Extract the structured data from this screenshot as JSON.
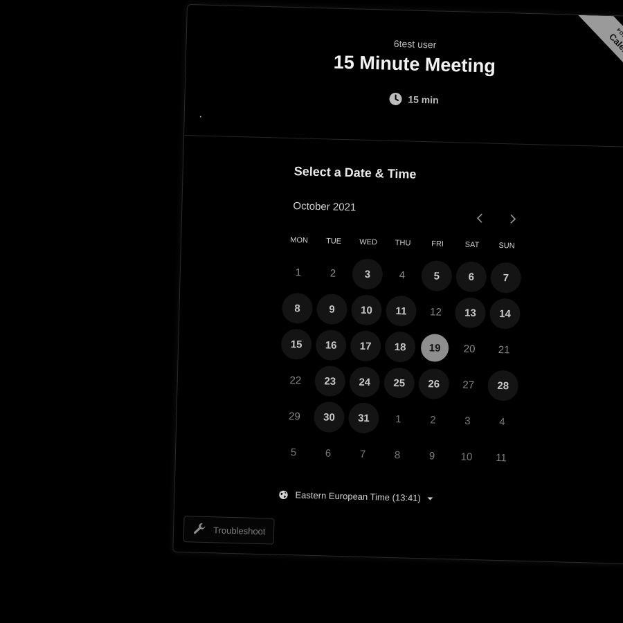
{
  "header": {
    "host_name": "6test user",
    "event_title": "15 Minute Meeting",
    "duration": "15 min"
  },
  "ribbon": {
    "small": "POWERED BY",
    "big": "Calendly"
  },
  "calendar": {
    "section_title": "Select a Date & Time",
    "month_label": "October 2021",
    "weekdays": [
      "MON",
      "TUE",
      "WED",
      "THU",
      "FRI",
      "SAT",
      "SUN"
    ],
    "days": [
      {
        "label": "1",
        "state": "unavailable"
      },
      {
        "label": "2",
        "state": "unavailable"
      },
      {
        "label": "3",
        "state": "available"
      },
      {
        "label": "4",
        "state": "unavailable"
      },
      {
        "label": "5",
        "state": "available"
      },
      {
        "label": "6",
        "state": "available"
      },
      {
        "label": "7",
        "state": "available"
      },
      {
        "label": "8",
        "state": "available"
      },
      {
        "label": "9",
        "state": "available"
      },
      {
        "label": "10",
        "state": "available"
      },
      {
        "label": "11",
        "state": "available"
      },
      {
        "label": "12",
        "state": "unavailable"
      },
      {
        "label": "13",
        "state": "available"
      },
      {
        "label": "14",
        "state": "available"
      },
      {
        "label": "15",
        "state": "available"
      },
      {
        "label": "16",
        "state": "available"
      },
      {
        "label": "17",
        "state": "available"
      },
      {
        "label": "18",
        "state": "available"
      },
      {
        "label": "19",
        "state": "selected"
      },
      {
        "label": "20",
        "state": "unavailable"
      },
      {
        "label": "21",
        "state": "unavailable"
      },
      {
        "label": "22",
        "state": "unavailable"
      },
      {
        "label": "23",
        "state": "available"
      },
      {
        "label": "24",
        "state": "available"
      },
      {
        "label": "25",
        "state": "available"
      },
      {
        "label": "26",
        "state": "available"
      },
      {
        "label": "27",
        "state": "unavailable"
      },
      {
        "label": "28",
        "state": "available"
      },
      {
        "label": "29",
        "state": "unavailable"
      },
      {
        "label": "30",
        "state": "available"
      },
      {
        "label": "31",
        "state": "available"
      },
      {
        "label": "1",
        "state": "other"
      },
      {
        "label": "2",
        "state": "other"
      },
      {
        "label": "3",
        "state": "other"
      },
      {
        "label": "4",
        "state": "other"
      },
      {
        "label": "5",
        "state": "other"
      },
      {
        "label": "6",
        "state": "other"
      },
      {
        "label": "7",
        "state": "other"
      },
      {
        "label": "8",
        "state": "other"
      },
      {
        "label": "9",
        "state": "other"
      },
      {
        "label": "10",
        "state": "other"
      },
      {
        "label": "11",
        "state": "other"
      }
    ]
  },
  "timezone": {
    "label": "Eastern European Time (13:41)"
  },
  "troubleshoot": {
    "label": "Troubleshoot"
  },
  "icons": {
    "duration": "clock-icon",
    "previous_month": "chevron-left-icon",
    "next_month": "chevron-right-icon",
    "timezone": "globe-icon",
    "timezone_dropdown": "caret-down-icon",
    "troubleshoot": "wrench-icon"
  },
  "colors": {
    "background": "#000000",
    "available_day_bg": "#141414",
    "selected_day_bg": "#8e8e8e",
    "ribbon_bg": "#9a9a9a"
  }
}
